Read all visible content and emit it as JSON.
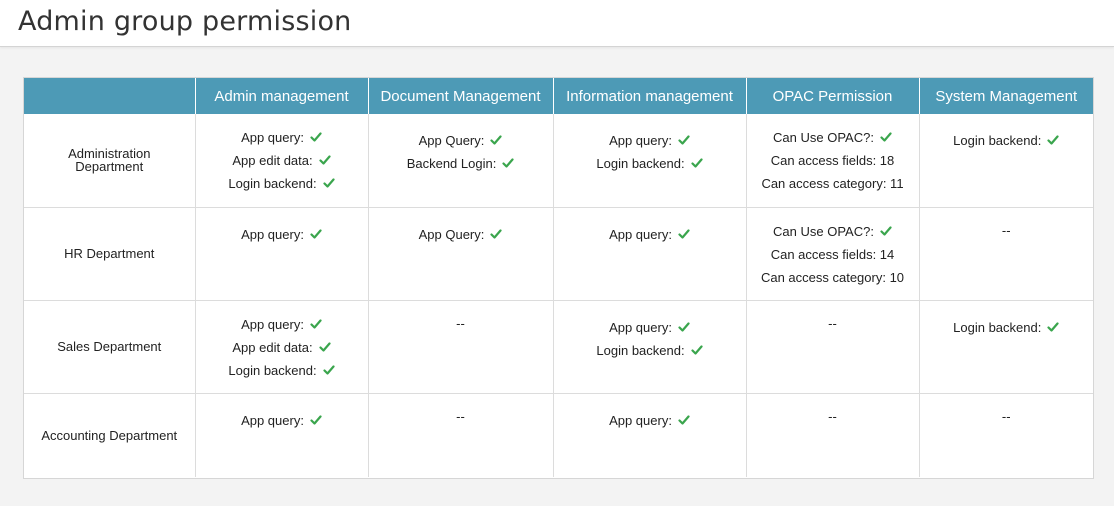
{
  "page": {
    "title": "Admin group permission"
  },
  "colors": {
    "header_bg": "#4d9ab6",
    "check": "#3aa54d"
  },
  "columns": [
    "",
    "Admin management",
    "Document Management",
    "Information management",
    "OPAC Permission",
    "System Management"
  ],
  "rows": [
    {
      "department": "Administration Department",
      "admin": [
        "App query:",
        "App edit data:",
        "Login backend:"
      ],
      "document": [
        "App Query:",
        "Backend Login:"
      ],
      "information": [
        "App query:",
        "Login backend:"
      ],
      "opac": {
        "can_use": "Can Use OPAC?:",
        "fields": "Can access fields: 18",
        "category": "Can access category: 11"
      },
      "system": [
        "Login backend:"
      ]
    },
    {
      "department": "HR Department",
      "admin": [
        "App query:"
      ],
      "document": [
        "App Query:"
      ],
      "information": [
        "App query:"
      ],
      "opac": {
        "can_use": "Can Use OPAC?:",
        "fields": "Can access fields: 14",
        "category": "Can access category: 10"
      },
      "system": "--"
    },
    {
      "department": "Sales Department",
      "admin": [
        "App query:",
        "App edit data:",
        "Login backend:"
      ],
      "document": "--",
      "information": [
        "App query:",
        "Login backend:"
      ],
      "opac": "--",
      "system": [
        "Login backend:"
      ]
    },
    {
      "department": "Accounting Department",
      "admin": [
        "App query:"
      ],
      "document": "--",
      "information": [
        "App query:"
      ],
      "opac": "--",
      "system": "--"
    }
  ]
}
